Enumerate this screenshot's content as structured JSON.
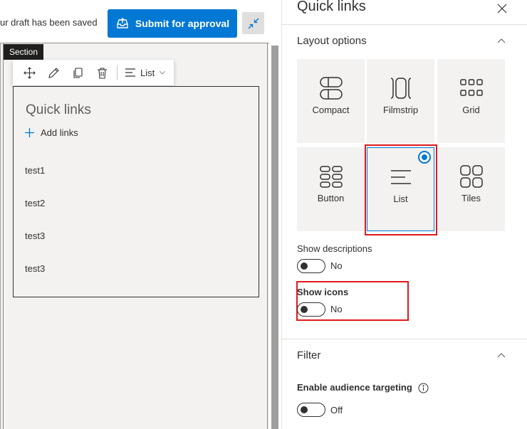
{
  "topbar": {
    "draft_status": "ur draft has been saved",
    "submit_label": "Submit for approval",
    "submit_icon": "inbox-upload-icon",
    "collapse_icon": "collapse-arrows-icon"
  },
  "canvas": {
    "section_tag": "Section",
    "toolbar": {
      "icons": [
        "move-icon",
        "edit-icon",
        "duplicate-icon",
        "delete-icon"
      ],
      "layout_label": "List"
    },
    "webpart": {
      "title": "Quick links",
      "add_links_label": "Add links",
      "links": [
        "test1",
        "test2",
        "test3",
        "test3"
      ]
    }
  },
  "panel": {
    "title": "Quick links",
    "layout_group": {
      "header": "Layout options",
      "options": [
        {
          "label": "Compact",
          "icon": "compact-layout-icon",
          "selected": false
        },
        {
          "label": "Filmstrip",
          "icon": "filmstrip-layout-icon",
          "selected": false
        },
        {
          "label": "Grid",
          "icon": "grid-layout-icon",
          "selected": false
        },
        {
          "label": "Button",
          "icon": "button-layout-icon",
          "selected": false
        },
        {
          "label": "List",
          "icon": "list-layout-icon",
          "selected": true
        },
        {
          "label": "Tiles",
          "icon": "tiles-layout-icon",
          "selected": false
        }
      ]
    },
    "show_descriptions": {
      "label": "Show descriptions",
      "value": "No"
    },
    "show_icons": {
      "label": "Show icons",
      "value": "No"
    },
    "filter_group": {
      "header": "Filter",
      "audience_targeting": {
        "label": "Enable audience targeting",
        "value": "Off"
      }
    }
  },
  "colors": {
    "accent": "#0078d4",
    "highlight": "#e0191b",
    "canvas_bg": "#f3f2f1"
  }
}
